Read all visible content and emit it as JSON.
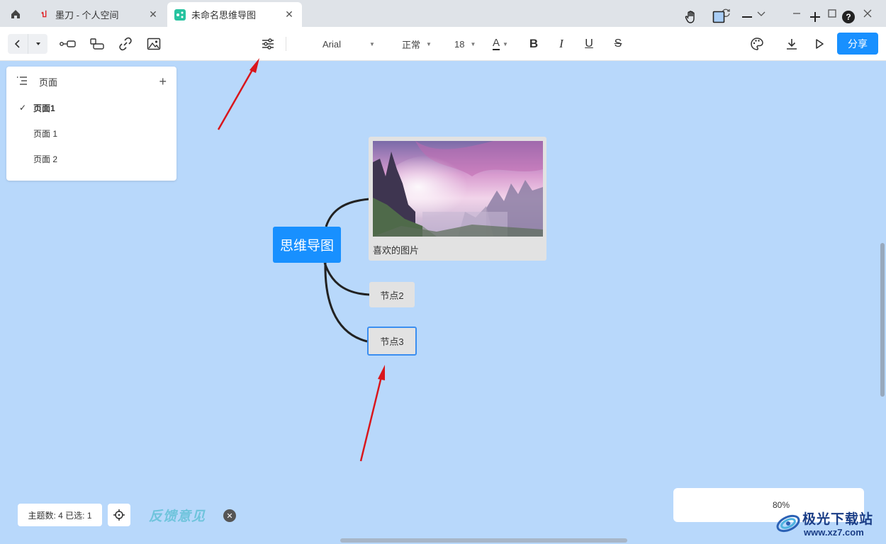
{
  "tabs": [
    {
      "title": "墨刀 - 个人空间",
      "active": false
    },
    {
      "title": "未命名思维导图",
      "active": true
    }
  ],
  "toolbar": {
    "font": "Arial",
    "weight": "正常",
    "size": "18",
    "color_label": "A",
    "share_label": "分享",
    "bold_label": "B",
    "italic_label": "I",
    "underline_label": "U",
    "strike_label": "S"
  },
  "pages_panel": {
    "title": "页面",
    "items": [
      "页面1",
      "页面 1",
      "页面 2"
    ],
    "selected_index": 0
  },
  "mindmap": {
    "root": "思维导图",
    "image_caption": "喜欢的图片",
    "children": [
      "节点2",
      "节点3"
    ],
    "selected_child": "节点3"
  },
  "status": {
    "text": "主题数: 4 已选: 1"
  },
  "feedback": {
    "label": "反馈意见"
  },
  "zoom": {
    "value": "80%"
  },
  "watermark": {
    "title": "极光下载站",
    "url": "www.xz7.com"
  },
  "colors": {
    "accent": "#1890ff",
    "canvas": "#b8d8fb",
    "arrow": "#d9161c"
  }
}
